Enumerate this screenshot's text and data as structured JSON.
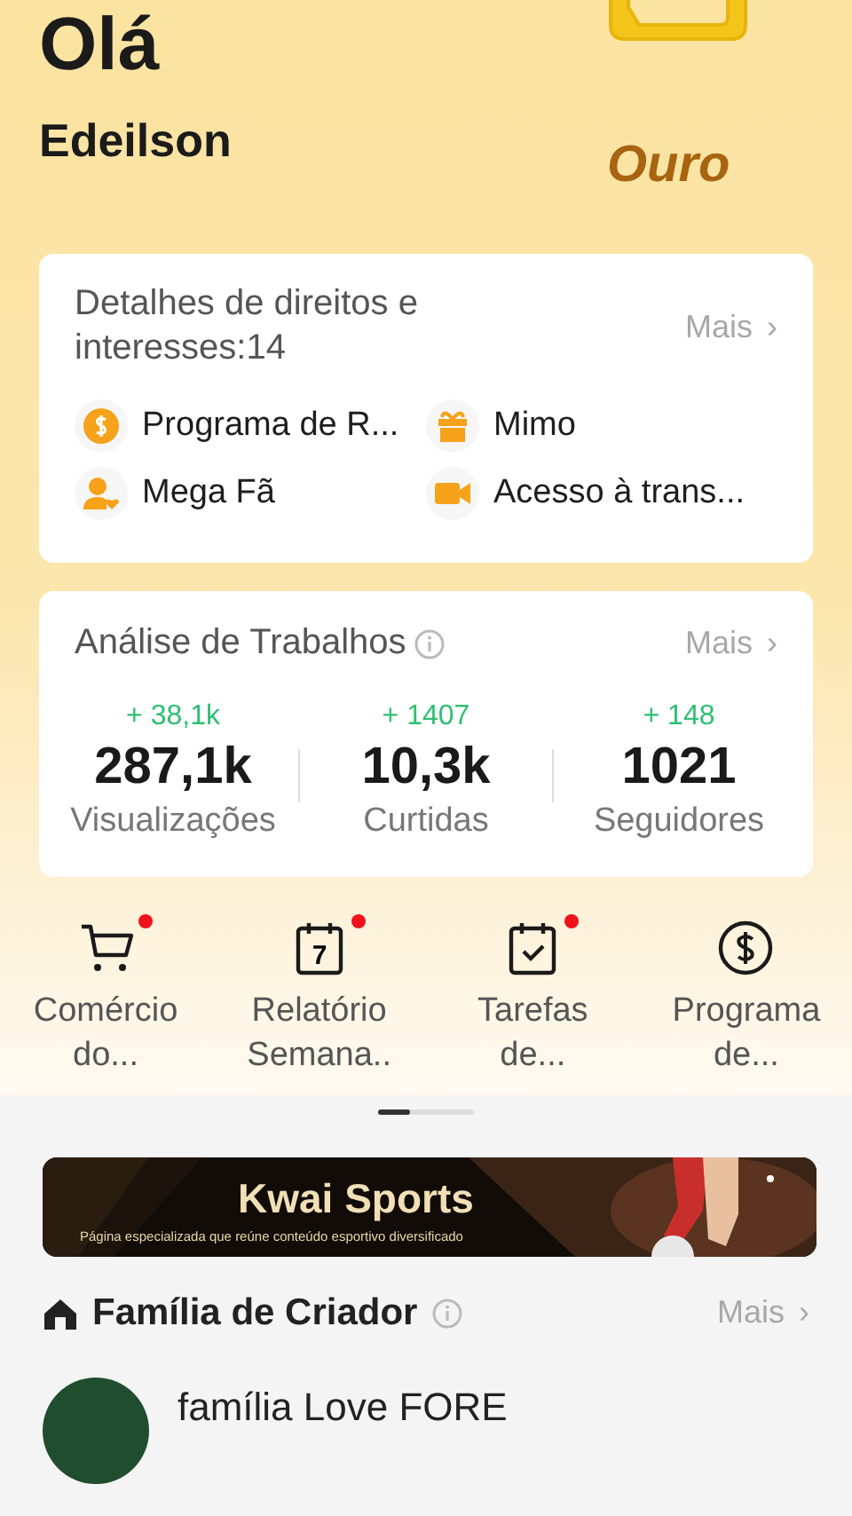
{
  "greeting": "Olá",
  "username": "Edeilson",
  "level_badge": {
    "label": "Ouro"
  },
  "rights_card": {
    "title": "Detalhes de direitos e interesses:14",
    "more": "Mais",
    "more_icon": "›",
    "items": [
      {
        "label": "Programa de R..."
      },
      {
        "label": "Mimo"
      },
      {
        "label": "Mega Fã"
      },
      {
        "label": "Acesso à trans..."
      }
    ]
  },
  "works_card": {
    "title": "Análise de Trabalhos",
    "more": "Mais",
    "more_icon": "›",
    "stats": [
      {
        "delta": "+ 38,1k",
        "value": "287,1k",
        "label": "Visualizações"
      },
      {
        "delta": "+ 1407",
        "value": "10,3k",
        "label": "Curtidas"
      },
      {
        "delta": "+ 148",
        "value": "1021",
        "label": "Seguidores"
      }
    ]
  },
  "shortcuts": [
    {
      "label": "Comércio do...",
      "new": true
    },
    {
      "label": "Relatório Semana..",
      "new": true,
      "icon_text": "7"
    },
    {
      "label": "Tarefas de...",
      "new": true
    },
    {
      "label": "Programa de...",
      "new": false
    }
  ],
  "banner": {
    "title": "Kwai Sports",
    "subtitle": "Página especializada que reúne conteúdo esportivo diversificado"
  },
  "family": {
    "title": "Família de Criador",
    "more": "Mais",
    "more_icon": "›",
    "entries": [
      {
        "name": "família Love FORE"
      }
    ]
  }
}
